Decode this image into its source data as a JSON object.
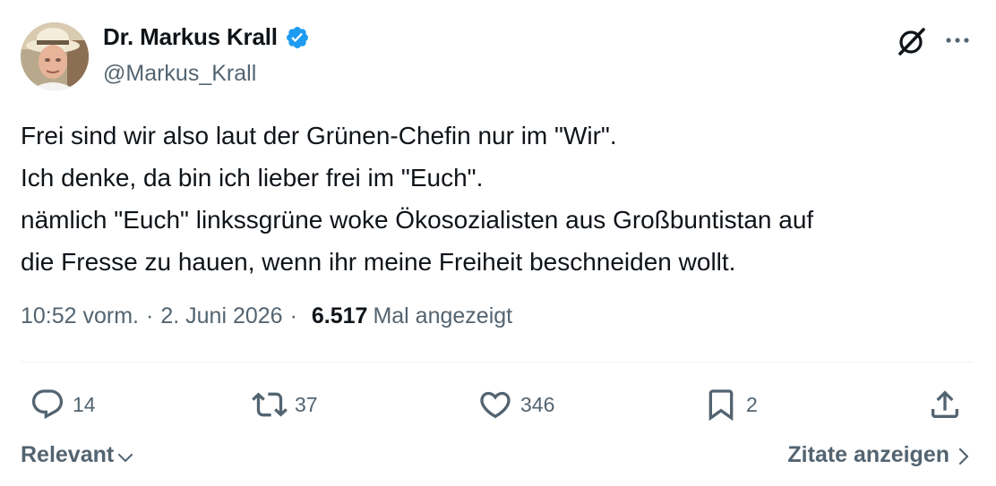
{
  "author": {
    "display_name": "Dr. Markus Krall",
    "handle": "@Markus_Krall",
    "verified_color": "#1d9bf0"
  },
  "tweet": {
    "lines": [
      "Frei sind wir also laut der Grünen-Chefin nur im \"Wir\".",
      "Ich denke, da bin ich lieber frei im \"Euch\".",
      "nämlich \"Euch\" linkssgrüne woke Ökosozialisten aus Großbuntistan auf",
      "die Fresse zu hauen, wenn ihr meine Freiheit beschneiden wollt."
    ]
  },
  "meta": {
    "time": "10:52 vorm.",
    "separator": "·",
    "date": "2. Juni 2026",
    "views_count": "6.517",
    "views_label": "Mal angezeigt"
  },
  "actions": {
    "reply_count": "14",
    "retweet_count": "37",
    "like_count": "346",
    "bookmark_count": "2"
  },
  "footer": {
    "sort_label": "Relevant",
    "quotes_label": "Zitate anzeigen"
  },
  "icons": {
    "grok": "grok-icon",
    "more": "more-icon",
    "reply": "reply-icon",
    "retweet": "retweet-icon",
    "like": "heart-icon",
    "bookmark": "bookmark-icon",
    "share": "share-icon"
  }
}
